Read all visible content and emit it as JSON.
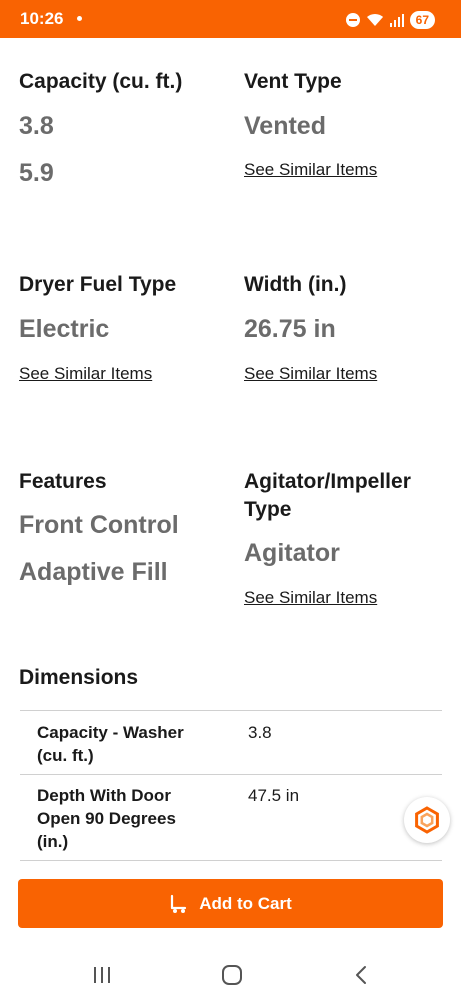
{
  "status_bar": {
    "time": "10:26",
    "battery": "67",
    "accent_color": "#f96302"
  },
  "specs": [
    {
      "title": "Capacity (cu. ft.)",
      "values": [
        "3.8",
        "5.9"
      ],
      "link": ""
    },
    {
      "title": "Vent Type",
      "values": [
        "Vented"
      ],
      "link": "See Similar Items"
    },
    {
      "title": "Dryer Fuel Type",
      "values": [
        "Electric"
      ],
      "link": "See Similar Items"
    },
    {
      "title": "Width (in.)",
      "values": [
        "26.75 in"
      ],
      "link": "See Similar Items"
    },
    {
      "title": "Features",
      "values": [
        "Front Control",
        "Adaptive Fill"
      ],
      "link": ""
    },
    {
      "title_line1": "Agitator/Impeller",
      "title_line2": "Type",
      "values": [
        "Agitator"
      ],
      "link": "See Similar Items"
    }
  ],
  "dimensions": {
    "title": "Dimensions",
    "rows": [
      {
        "label_lines": [
          "Capacity - Washer",
          "(cu. ft.)"
        ],
        "value": "3.8"
      },
      {
        "label_lines": [
          "Depth With Door",
          "Open 90 Degrees",
          "(in.)"
        ],
        "value": "47.5 in"
      }
    ]
  },
  "cta": {
    "label": "Add to Cart",
    "icon": "dolly-cart-icon"
  },
  "nav": {
    "icons": [
      "recent-apps-icon",
      "home-icon",
      "back-icon"
    ]
  }
}
